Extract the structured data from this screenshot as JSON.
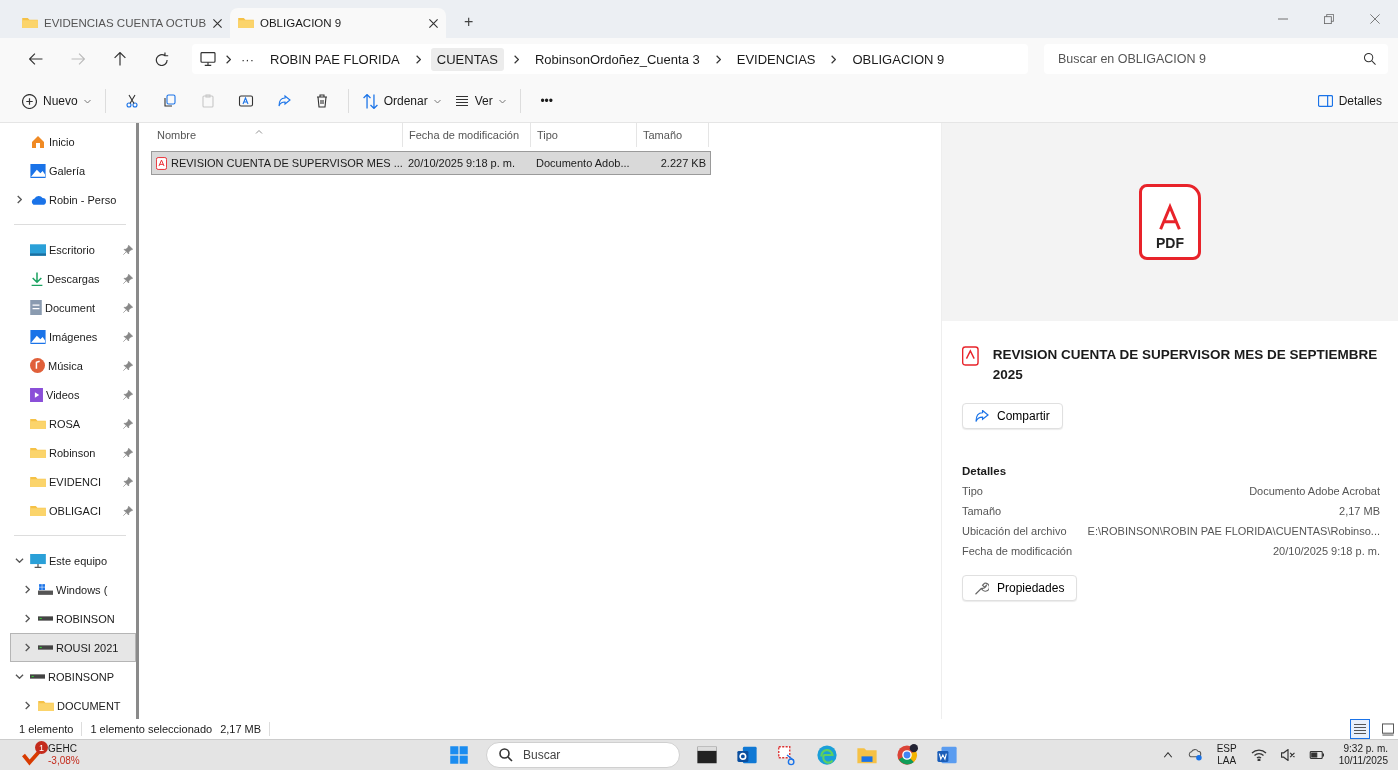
{
  "tabs": [
    {
      "label": "EVIDENCIAS CUENTA OCTUB",
      "selected": false
    },
    {
      "label": "OBLIGACION 9",
      "selected": true
    }
  ],
  "window_controls": {
    "new_tab": "+"
  },
  "address_bar": {
    "more": "···",
    "crumbs": [
      {
        "label": "ROBIN PAE FLORIDA",
        "highlighted": false
      },
      {
        "label": "CUENTAS",
        "highlighted": true
      },
      {
        "label": "RobinsonOrdoñez_Cuenta 3",
        "highlighted": false
      },
      {
        "label": "EVIDENCIAS",
        "highlighted": false
      },
      {
        "label": "OBLIGACION 9",
        "highlighted": false
      }
    ],
    "back_disabled": false,
    "forward_disabled": true
  },
  "search": {
    "placeholder": "Buscar en OBLIGACION 9"
  },
  "toolbar": {
    "new": "Nuevo",
    "items": [
      {
        "kind": "cut",
        "disabled": false
      },
      {
        "kind": "copy",
        "disabled": false
      },
      {
        "kind": "paste",
        "disabled": true
      },
      {
        "kind": "rename",
        "disabled": false
      },
      {
        "kind": "share",
        "disabled": false
      },
      {
        "kind": "delete",
        "disabled": false
      }
    ],
    "sort": "Ordenar",
    "view": "Ver",
    "more": "•••",
    "details": "Detalles"
  },
  "sidebar": {
    "groups": [
      [
        {
          "label": "Inicio",
          "kind": "home",
          "selected": false
        },
        {
          "label": "Galería",
          "kind": "gallery",
          "selected": false
        },
        {
          "label": "Robin - Perso",
          "kind": "cloud",
          "selected": false,
          "expanded": false
        }
      ],
      [
        {
          "label": "Escritorio",
          "kind": "desktop",
          "pinned": true,
          "selected": false
        },
        {
          "label": "Descargas",
          "kind": "download",
          "pinned": true,
          "selected": false
        },
        {
          "label": "Document",
          "kind": "documents",
          "pinned": true,
          "selected": false
        },
        {
          "label": "Imágenes",
          "kind": "pictures",
          "pinned": true,
          "selected": false
        },
        {
          "label": "Música",
          "kind": "music",
          "pinned": true,
          "selected": false
        },
        {
          "label": "Videos",
          "kind": "videos",
          "pinned": true,
          "selected": false
        },
        {
          "label": "ROSA",
          "kind": "folder",
          "pinned": true,
          "selected": false
        },
        {
          "label": "Robinson",
          "kind": "folder",
          "pinned": true,
          "selected": false
        },
        {
          "label": "EVIDENCI",
          "kind": "folder",
          "pinned": true,
          "selected": false
        },
        {
          "label": "OBLIGACI",
          "kind": "folder",
          "pinned": true,
          "selected": false
        }
      ],
      [
        {
          "label": "Este equipo",
          "kind": "pc",
          "selected": false,
          "expanded": true,
          "children": [
            {
              "label": "Windows (",
              "kind": "windrive",
              "selected": false,
              "expanded": false
            },
            {
              "label": "ROBINSON",
              "kind": "drive",
              "selected": false,
              "expanded": false
            },
            {
              "label": "ROUSI 2021",
              "kind": "drive",
              "selected": true,
              "expanded": false
            }
          ]
        },
        {
          "label": "ROBINSONP",
          "kind": "drive",
          "selected": false,
          "expanded": true,
          "children": [
            {
              "label": "DOCUMENT",
              "kind": "folder",
              "selected": false,
              "expanded": false
            }
          ]
        }
      ]
    ]
  },
  "table": {
    "columns": [
      "Nombre",
      "Fecha de modificación",
      "Tipo",
      "Tamaño"
    ],
    "rows": [
      {
        "name": "REVISION CUENTA DE SUPERVISOR MES ...",
        "date": "20/10/2025 9:18 p. m.",
        "type": "Documento Adob...",
        "size": "2.227 KB",
        "selected": true
      }
    ]
  },
  "preview": {
    "icon_label": "PDF",
    "title": "REVISION CUENTA DE SUPERVISOR MES DE SEPTIEMBRE 2025",
    "share": "Compartir",
    "details_heading": "Detalles",
    "details": [
      {
        "label": "Tipo",
        "value": "Documento Adobe Acrobat"
      },
      {
        "label": "Tamaño",
        "value": "2,17 MB"
      },
      {
        "label": "Ubicación del archivo",
        "value": "E:\\ROBINSON\\ROBIN PAE FLORIDA\\CUENTAS\\Robinso..."
      },
      {
        "label": "Fecha de modificación",
        "value": "20/10/2025 9:18 p. m."
      }
    ],
    "properties": "Propiedades"
  },
  "status_bar": {
    "count": "1 elemento",
    "selection": "1 elemento seleccionado",
    "size": "2,17 MB",
    "views": [
      {
        "kind": "details",
        "selected": true
      },
      {
        "kind": "tiles",
        "selected": false
      }
    ]
  },
  "taskbar": {
    "widget": {
      "badge": "1",
      "name": "GEHC",
      "change": "-3,08%"
    },
    "search": "Buscar",
    "tray": {
      "language": "ESP",
      "layout": "LAA",
      "time": "9:32 p. m.",
      "date": "10/11/2025"
    }
  }
}
